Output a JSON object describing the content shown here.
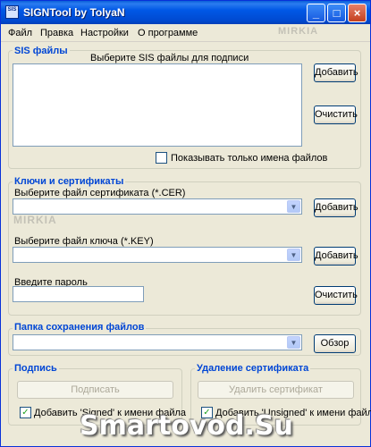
{
  "window": {
    "title": "SIGNTool by TolyaN",
    "app_icon_text": "SIS",
    "controls": [
      "_",
      "□",
      "×"
    ]
  },
  "menu": [
    "Файл",
    "Правка",
    "Настройки",
    "О программе"
  ],
  "watermark_small": "MIRKIA",
  "sis": {
    "title": "SIS файлы",
    "hint": "Выберите SIS файлы для подписи",
    "add_button": "Добавить",
    "clear_button": "Очистить",
    "names_only_checkbox": "Показывать только имена файлов",
    "names_only_checked": false
  },
  "keys": {
    "title": "Ключи и сертификаты",
    "cert_label": "Выберите файл сертификата (*.CER)",
    "cert_value": "",
    "cert_add_button": "Добавить",
    "key_label": "Выберите файл ключа (*.KEY)",
    "key_value": "",
    "key_add_button": "Добавить",
    "password_label": "Введите пароль",
    "password_value": "",
    "clear_button": "Очистить"
  },
  "save_folder": {
    "title": "Папка сохранения файлов",
    "value": "",
    "browse_button": "Обзор"
  },
  "sign": {
    "title": "Подпись",
    "sign_button": "Подписать",
    "add_signed_checkbox": "Добавить 'Signed' к имени файла",
    "add_signed_checked": true
  },
  "remove_cert": {
    "title": "Удаление сертификата",
    "remove_button": "Удалить сертификат",
    "add_unsigned_checkbox": "Добавить 'Unsigned' к имени файла",
    "add_unsigned_checked": true
  },
  "watermark_big": "Smartovod.Su"
}
